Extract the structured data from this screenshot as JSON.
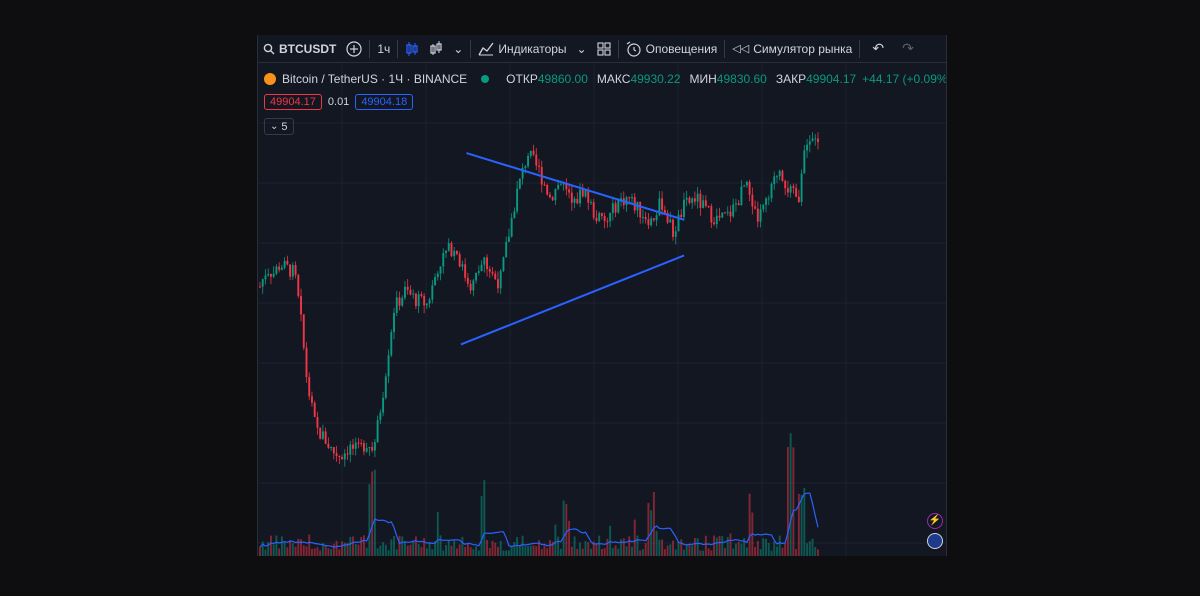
{
  "toolbar": {
    "symbol": "BTCUSDT",
    "interval": "1ч",
    "indicators": "Индикаторы",
    "alerts": "Оповещения",
    "replay": "Симулятор рынка"
  },
  "legend": {
    "title": "Bitcoin / TetherUS · 1Ч · BINANCE",
    "open_label": "ОТКР",
    "open": "49860.00",
    "high_label": "МАКС",
    "high": "49930.22",
    "low_label": "МИН",
    "low": "49830.60",
    "close_label": "ЗАКР",
    "close": "49904.17",
    "change": "+44.17 (+0.09%)"
  },
  "pricebox": {
    "sell": "49904.17",
    "spread": "0.01",
    "buy": "49904.18"
  },
  "collapse": {
    "count": "5"
  },
  "colors": {
    "up": "#089981",
    "down": "#f23645",
    "trendline": "#2962ff",
    "volume_ma": "#2962ff",
    "background": "#131722"
  },
  "chart_data": {
    "type": "candlestick",
    "close_path": [
      [
        0,
        0.52
      ],
      [
        0.012,
        0.56
      ],
      [
        0.024,
        0.55
      ],
      [
        0.036,
        0.57
      ],
      [
        0.05,
        0.56
      ],
      [
        0.062,
        0.55
      ],
      [
        0.072,
        0.46
      ],
      [
        0.085,
        0.3
      ],
      [
        0.1,
        0.2
      ],
      [
        0.115,
        0.18
      ],
      [
        0.13,
        0.15
      ],
      [
        0.145,
        0.14
      ],
      [
        0.16,
        0.16
      ],
      [
        0.175,
        0.15
      ],
      [
        0.19,
        0.17
      ],
      [
        0.205,
        0.16
      ],
      [
        0.22,
        0.28
      ],
      [
        0.24,
        0.47
      ],
      [
        0.26,
        0.51
      ],
      [
        0.28,
        0.49
      ],
      [
        0.3,
        0.48
      ],
      [
        0.32,
        0.57
      ],
      [
        0.335,
        0.6
      ],
      [
        0.35,
        0.61
      ],
      [
        0.365,
        0.55
      ],
      [
        0.38,
        0.52
      ],
      [
        0.4,
        0.58
      ],
      [
        0.42,
        0.54
      ],
      [
        0.43,
        0.53
      ],
      [
        0.44,
        0.6
      ],
      [
        0.46,
        0.73
      ],
      [
        0.48,
        0.82
      ],
      [
        0.5,
        0.78
      ],
      [
        0.52,
        0.72
      ],
      [
        0.54,
        0.76
      ],
      [
        0.56,
        0.7
      ],
      [
        0.58,
        0.74
      ],
      [
        0.6,
        0.68
      ],
      [
        0.62,
        0.66
      ],
      [
        0.64,
        0.71
      ],
      [
        0.66,
        0.72
      ],
      [
        0.68,
        0.69
      ],
      [
        0.7,
        0.67
      ],
      [
        0.72,
        0.71
      ],
      [
        0.74,
        0.64
      ],
      [
        0.76,
        0.7
      ],
      [
        0.78,
        0.72
      ],
      [
        0.8,
        0.69
      ],
      [
        0.82,
        0.67
      ],
      [
        0.84,
        0.68
      ],
      [
        0.855,
        0.71
      ],
      [
        0.87,
        0.75
      ],
      [
        0.89,
        0.67
      ],
      [
        0.91,
        0.71
      ],
      [
        0.93,
        0.79
      ],
      [
        0.95,
        0.73
      ],
      [
        0.965,
        0.72
      ],
      [
        0.98,
        0.85
      ],
      [
        1.0,
        0.84
      ]
    ],
    "volume_spikes": [
      [
        0.2,
        0.9
      ],
      [
        0.4,
        0.6
      ],
      [
        0.55,
        0.45
      ],
      [
        0.7,
        0.5
      ],
      [
        0.88,
        0.55
      ],
      [
        0.95,
        0.95
      ],
      [
        0.97,
        0.7
      ]
    ],
    "trendline_upper": [
      [
        0.37,
        0.82
      ],
      [
        0.76,
        0.67
      ]
    ],
    "trendline_lower": [
      [
        0.36,
        0.39
      ],
      [
        0.76,
        0.59
      ]
    ]
  }
}
